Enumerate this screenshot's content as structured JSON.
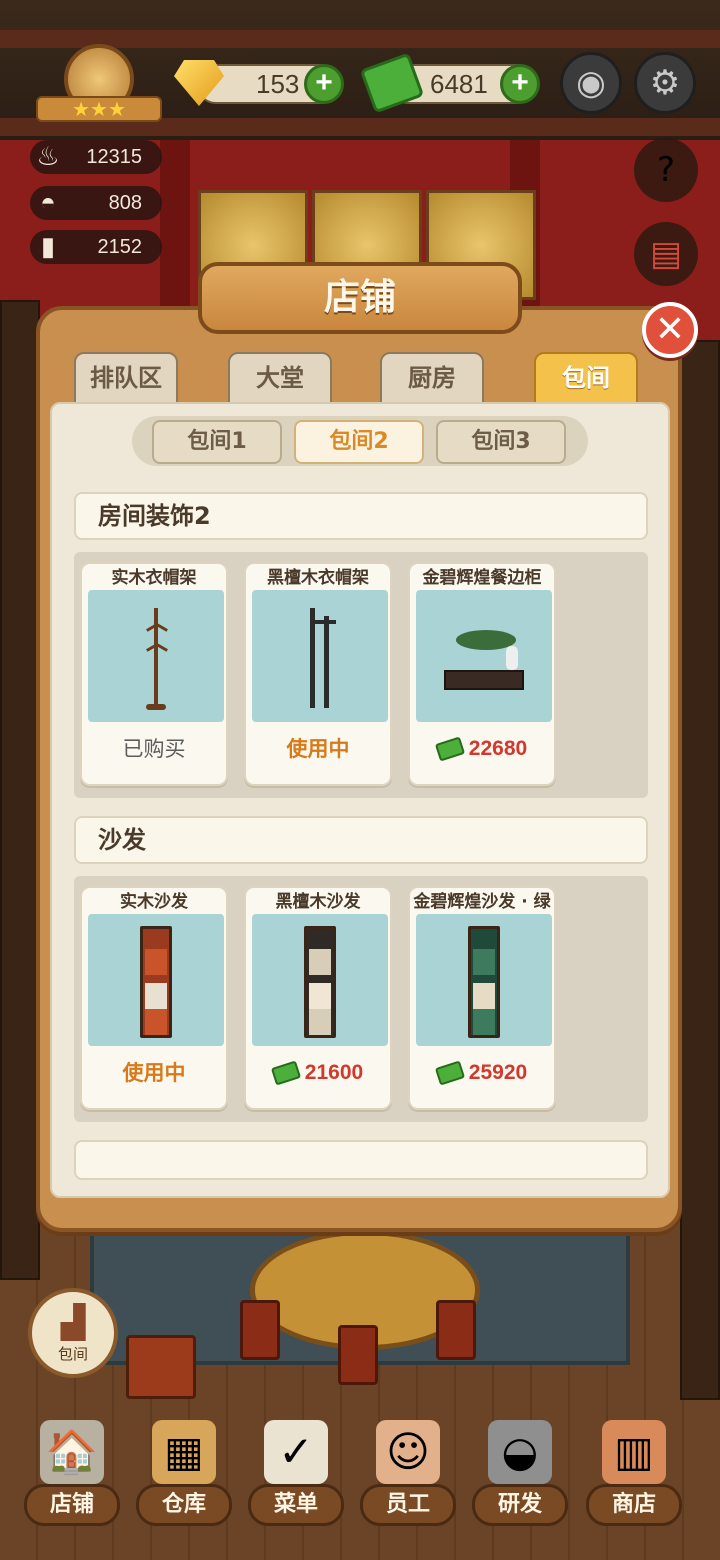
{
  "hud": {
    "gems": "153",
    "cash": "6481",
    "plus_symbol": "+",
    "stats": [
      {
        "icon": "pot-icon",
        "value": "12315"
      },
      {
        "icon": "dish-cover-icon",
        "value": "808"
      },
      {
        "icon": "recipe-book-icon",
        "value": "2152"
      }
    ]
  },
  "modal": {
    "title": "店铺",
    "close_symbol": "✕",
    "tabs": [
      "排队区",
      "大堂",
      "厨房",
      "包间"
    ],
    "active_tab": "包间",
    "subtabs": [
      "包间1",
      "包间2",
      "包间3"
    ],
    "active_subtab": "包间2",
    "sections": [
      {
        "title": "房间装饰2",
        "items": [
          {
            "name": "实木衣帽架",
            "status": "已购买"
          },
          {
            "name": "黑檀木衣帽架",
            "status": "使用中"
          },
          {
            "name": "金碧辉煌餐边柜",
            "price": "22680"
          }
        ]
      },
      {
        "title": "沙发",
        "items": [
          {
            "name": "实木沙发",
            "status": "使用中"
          },
          {
            "name": "黑檀木沙发",
            "price": "21600"
          },
          {
            "name": "金碧辉煌沙发 · 绿",
            "price": "25920"
          }
        ]
      }
    ]
  },
  "float_button": {
    "label": "包间",
    "icon": "sofa-icon"
  },
  "bottom_nav": [
    {
      "label": "店铺",
      "icon": "shop-building-icon"
    },
    {
      "label": "仓库",
      "icon": "boxes-icon"
    },
    {
      "label": "菜单",
      "icon": "clipboard-icon"
    },
    {
      "label": "员工",
      "icon": "staff-icon"
    },
    {
      "label": "研发",
      "icon": "wok-icon"
    },
    {
      "label": "商店",
      "icon": "store-icon"
    }
  ],
  "colors": {
    "accent_orange": "#d77a1a",
    "price_red": "#d2382e",
    "active_tab": "#f4c24a",
    "modal_wood": "#c88f4e"
  }
}
